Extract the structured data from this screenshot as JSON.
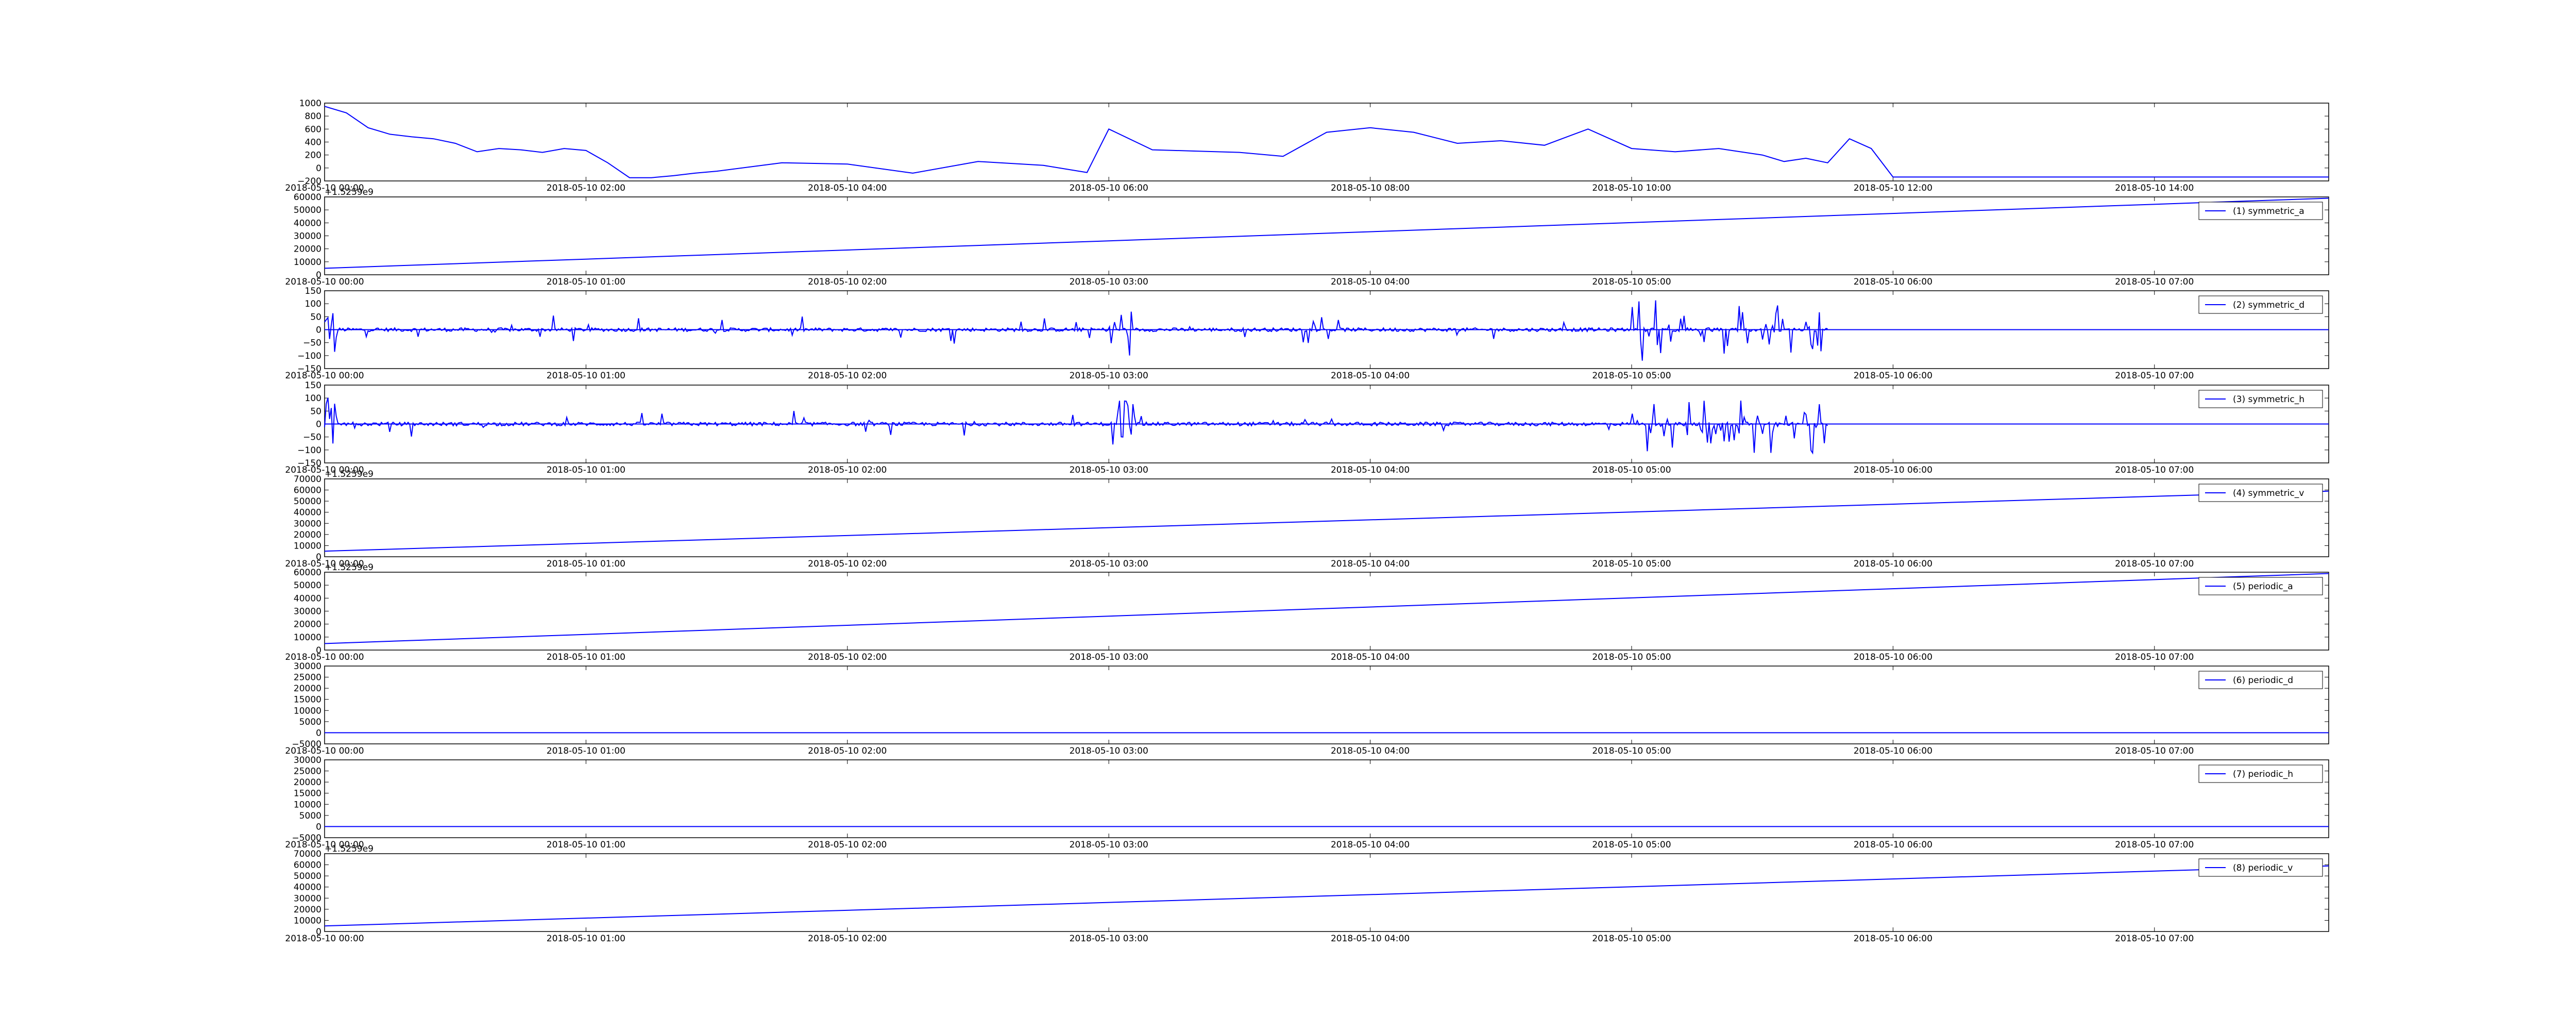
{
  "chart_data": [
    {
      "type": "line",
      "legend": null,
      "x_ticks": [
        "2018-05-10 00:00",
        "2018-05-10 02:00",
        "2018-05-10 04:00",
        "2018-05-10 06:00",
        "2018-05-10 08:00",
        "2018-05-10 10:00",
        "2018-05-10 12:00",
        "2018-05-10 14:00"
      ],
      "xlim": [
        "2018-05-10 00:00",
        "2018-05-10 15:20"
      ],
      "y_ticks": [
        "1000",
        "800",
        "600",
        "400",
        "200",
        "0",
        "−200"
      ],
      "ylim": [
        -200,
        1000
      ],
      "series": [
        {
          "x": [
            "2018-05-10 00:00",
            "2018-05-10 00:10",
            "2018-05-10 00:20",
            "2018-05-10 00:30",
            "2018-05-10 00:40",
            "2018-05-10 00:50",
            "2018-05-10 01:00",
            "2018-05-10 01:10",
            "2018-05-10 01:20",
            "2018-05-10 01:30",
            "2018-05-10 01:40",
            "2018-05-10 01:50",
            "2018-05-10 02:00",
            "2018-05-10 02:10",
            "2018-05-10 02:20",
            "2018-05-10 02:30",
            "2018-05-10 02:40",
            "2018-05-10 02:50",
            "2018-05-10 03:00",
            "2018-05-10 03:30",
            "2018-05-10 04:00",
            "2018-05-10 04:30",
            "2018-05-10 05:00",
            "2018-05-10 05:30",
            "2018-05-10 05:50",
            "2018-05-10 06:00",
            "2018-05-10 06:20",
            "2018-05-10 06:40",
            "2018-05-10 07:00",
            "2018-05-10 07:20",
            "2018-05-10 07:40",
            "2018-05-10 08:00",
            "2018-05-10 08:20",
            "2018-05-10 08:40",
            "2018-05-10 09:00",
            "2018-05-10 09:20",
            "2018-05-10 09:40",
            "2018-05-10 10:00",
            "2018-05-10 10:20",
            "2018-05-10 10:40",
            "2018-05-10 11:00",
            "2018-05-10 11:10",
            "2018-05-10 11:20",
            "2018-05-10 11:30",
            "2018-05-10 11:40",
            "2018-05-10 11:50",
            "2018-05-10 12:00",
            "2018-05-10 13:00",
            "2018-05-10 14:00",
            "2018-05-10 15:20"
          ],
          "y": [
            950,
            850,
            620,
            520,
            480,
            450,
            380,
            250,
            300,
            280,
            240,
            300,
            270,
            80,
            -150,
            -150,
            -120,
            -80,
            -50,
            80,
            60,
            -80,
            100,
            40,
            -70,
            600,
            280,
            260,
            240,
            180,
            550,
            620,
            550,
            380,
            420,
            350,
            600,
            300,
            250,
            300,
            200,
            100,
            150,
            80,
            450,
            300,
            -140,
            -140,
            -140,
            -140
          ]
        }
      ]
    },
    {
      "type": "line",
      "title": "",
      "offset_label": "+1.5259e9",
      "legend": "(1) symmetric_a",
      "x_ticks": [
        "2018-05-10 00:00",
        "2018-05-10 01:00",
        "2018-05-10 02:00",
        "2018-05-10 03:00",
        "2018-05-10 04:00",
        "2018-05-10 05:00",
        "2018-05-10 06:00",
        "2018-05-10 07:00"
      ],
      "xlim": [
        "2018-05-10 00:00",
        "2018-05-10 07:40"
      ],
      "y_ticks": [
        "60000",
        "50000",
        "40000",
        "30000",
        "20000",
        "10000",
        "0"
      ],
      "ylim": [
        0,
        60000
      ],
      "series": [
        {
          "name": "(1) symmetric_a",
          "x": [
            "2018-05-10 00:00",
            "2018-05-10 07:40"
          ],
          "y": [
            5000,
            59000
          ]
        }
      ]
    },
    {
      "type": "line",
      "legend": "(2) symmetric_d",
      "x_ticks": [
        "2018-05-10 00:00",
        "2018-05-10 01:00",
        "2018-05-10 02:00",
        "2018-05-10 03:00",
        "2018-05-10 04:00",
        "2018-05-10 05:00",
        "2018-05-10 06:00",
        "2018-05-10 07:00"
      ],
      "xlim": [
        "2018-05-10 00:00",
        "2018-05-10 07:40"
      ],
      "y_ticks": [
        "150",
        "100",
        "50",
        "0",
        "−50",
        "−100",
        "−150"
      ],
      "ylim": [
        -150,
        150
      ],
      "series": [
        {
          "name": "(2) symmetric_d",
          "noise_after": "2018-05-10 05:45",
          "flat_value": 0
        }
      ]
    },
    {
      "type": "line",
      "legend": "(3) symmetric_h",
      "x_ticks": [
        "2018-05-10 00:00",
        "2018-05-10 01:00",
        "2018-05-10 02:00",
        "2018-05-10 03:00",
        "2018-05-10 04:00",
        "2018-05-10 05:00",
        "2018-05-10 06:00",
        "2018-05-10 07:00"
      ],
      "xlim": [
        "2018-05-10 00:00",
        "2018-05-10 07:40"
      ],
      "y_ticks": [
        "150",
        "100",
        "50",
        "0",
        "−50",
        "−100",
        "−150"
      ],
      "ylim": [
        -150,
        150
      ],
      "series": [
        {
          "name": "(3) symmetric_h",
          "noise_after": "2018-05-10 05:45",
          "flat_value": 0
        }
      ]
    },
    {
      "type": "line",
      "offset_label": "+1.5259e9",
      "legend": "(4) symmetric_v",
      "x_ticks": [
        "2018-05-10 00:00",
        "2018-05-10 01:00",
        "2018-05-10 02:00",
        "2018-05-10 03:00",
        "2018-05-10 04:00",
        "2018-05-10 05:00",
        "2018-05-10 06:00",
        "2018-05-10 07:00"
      ],
      "xlim": [
        "2018-05-10 00:00",
        "2018-05-10 07:40"
      ],
      "y_ticks": [
        "70000",
        "60000",
        "50000",
        "40000",
        "30000",
        "20000",
        "10000",
        "0"
      ],
      "ylim": [
        0,
        70000
      ],
      "series": [
        {
          "name": "(4) symmetric_v",
          "x": [
            "2018-05-10 00:00",
            "2018-05-10 07:40"
          ],
          "y": [
            5000,
            59000
          ]
        }
      ]
    },
    {
      "type": "line",
      "offset_label": "+1.5259e9",
      "legend": "(5) periodic_a",
      "x_ticks": [
        "2018-05-10 00:00",
        "2018-05-10 01:00",
        "2018-05-10 02:00",
        "2018-05-10 03:00",
        "2018-05-10 04:00",
        "2018-05-10 05:00",
        "2018-05-10 06:00",
        "2018-05-10 07:00"
      ],
      "xlim": [
        "2018-05-10 00:00",
        "2018-05-10 07:40"
      ],
      "y_ticks": [
        "60000",
        "50000",
        "40000",
        "30000",
        "20000",
        "10000",
        "0"
      ],
      "ylim": [
        0,
        60000
      ],
      "series": [
        {
          "name": "(5) periodic_a",
          "x": [
            "2018-05-10 00:00",
            "2018-05-10 07:40"
          ],
          "y": [
            5000,
            59000
          ]
        }
      ]
    },
    {
      "type": "line",
      "legend": "(6) periodic_d",
      "x_ticks": [
        "2018-05-10 00:00",
        "2018-05-10 01:00",
        "2018-05-10 02:00",
        "2018-05-10 03:00",
        "2018-05-10 04:00",
        "2018-05-10 05:00",
        "2018-05-10 06:00",
        "2018-05-10 07:00"
      ],
      "xlim": [
        "2018-05-10 00:00",
        "2018-05-10 07:40"
      ],
      "y_ticks": [
        "30000",
        "25000",
        "20000",
        "15000",
        "10000",
        "5000",
        "0",
        "−5000"
      ],
      "ylim": [
        -5000,
        30000
      ],
      "series": [
        {
          "name": "(6) periodic_d",
          "x": [
            "2018-05-10 00:00",
            "2018-05-10 07:40"
          ],
          "y": [
            0,
            0
          ]
        }
      ]
    },
    {
      "type": "line",
      "legend": "(7) periodic_h",
      "x_ticks": [
        "2018-05-10 00:00",
        "2018-05-10 01:00",
        "2018-05-10 02:00",
        "2018-05-10 03:00",
        "2018-05-10 04:00",
        "2018-05-10 05:00",
        "2018-05-10 06:00",
        "2018-05-10 07:00"
      ],
      "xlim": [
        "2018-05-10 00:00",
        "2018-05-10 07:40"
      ],
      "y_ticks": [
        "30000",
        "25000",
        "20000",
        "15000",
        "10000",
        "5000",
        "0",
        "−5000"
      ],
      "ylim": [
        -5000,
        30000
      ],
      "series": [
        {
          "name": "(7) periodic_h",
          "x": [
            "2018-05-10 00:00",
            "2018-05-10 07:40"
          ],
          "y": [
            0,
            0
          ]
        }
      ]
    },
    {
      "type": "line",
      "offset_label": "+1.5259e9",
      "legend": "(8) periodic_v",
      "x_ticks": [
        "2018-05-10 00:00",
        "2018-05-10 01:00",
        "2018-05-10 02:00",
        "2018-05-10 03:00",
        "2018-05-10 04:00",
        "2018-05-10 05:00",
        "2018-05-10 06:00",
        "2018-05-10 07:00"
      ],
      "xlim": [
        "2018-05-10 00:00",
        "2018-05-10 07:40"
      ],
      "y_ticks": [
        "70000",
        "60000",
        "50000",
        "40000",
        "30000",
        "20000",
        "10000",
        "0"
      ],
      "ylim": [
        0,
        70000
      ],
      "series": [
        {
          "name": "(8) periodic_v",
          "x": [
            "2018-05-10 00:00",
            "2018-05-10 07:40"
          ],
          "y": [
            5000,
            59000
          ]
        }
      ]
    }
  ],
  "colors": {
    "line": "#0000ff",
    "axes": "#000000",
    "background": "#ffffff"
  }
}
